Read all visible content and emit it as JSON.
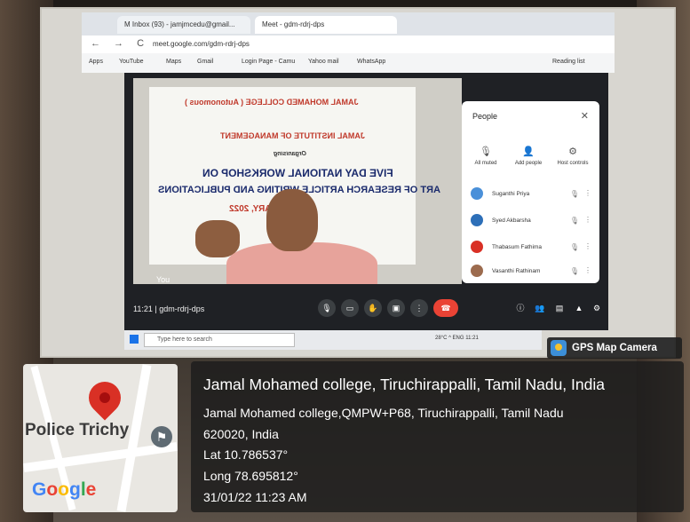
{
  "browser": {
    "tabs": [
      "M Inbox (93) - jamjmcedu@gmail...",
      "Meet - gdm-rdrj-dps"
    ],
    "url": "meet.google.com/gdm-rdrj-dps",
    "bookmarks": [
      "Apps",
      "YouTube",
      "Maps",
      "Gmail",
      "Login Page - Camu",
      "Yahoo mail",
      "WhatsApp"
    ],
    "reading_list": "Reading list"
  },
  "meet": {
    "banner_lines": [
      "JAMAL MOHAMED COLLEGE ( Autonomous )",
      "JAMAL INSTITUTE OF MANAGEMENT",
      "Organising",
      "FIVE DAY NATIONAL WORKSHOP ON",
      "ART OF RESEARCH ARTICLE WRITING AND PUBLICATIONS",
      "27 JANUARY, 2022"
    ],
    "self_label": "You",
    "people_panel": {
      "title": "People",
      "controls": [
        "All muted",
        "Add people",
        "Host controls"
      ],
      "participants": [
        {
          "name": "Suganthi Priya",
          "color": "#4a90d9"
        },
        {
          "name": "Syed Akbarsha",
          "color": "#2d6fb8"
        },
        {
          "name": "Thabasum Fathima",
          "color": "#d93025"
        },
        {
          "name": "Vasanthi Rathinam",
          "color": "#9c6b4e"
        }
      ]
    },
    "meeting_code": "11:21 | gdm-rdrj-dps"
  },
  "taskbar": {
    "search_placeholder": "Type here to search",
    "tray": "28°C ^ ENG 11:21"
  },
  "overlay": {
    "badge": "GPS Map Camera",
    "title": "Jamal Mohamed college, Tiruchirappalli, Tamil Nadu, India",
    "address_line1": "Jamal Mohamed college,QMPW+P68, Tiruchirappalli, Tamil Nadu",
    "address_line2": "620020, India",
    "lat": "Lat 10.786537°",
    "long": "Long 78.695812°",
    "datetime": "31/01/22 11:23 AM"
  },
  "map": {
    "label": "Police Trichy",
    "brand": "Google",
    "pin_color": "#d93025"
  }
}
